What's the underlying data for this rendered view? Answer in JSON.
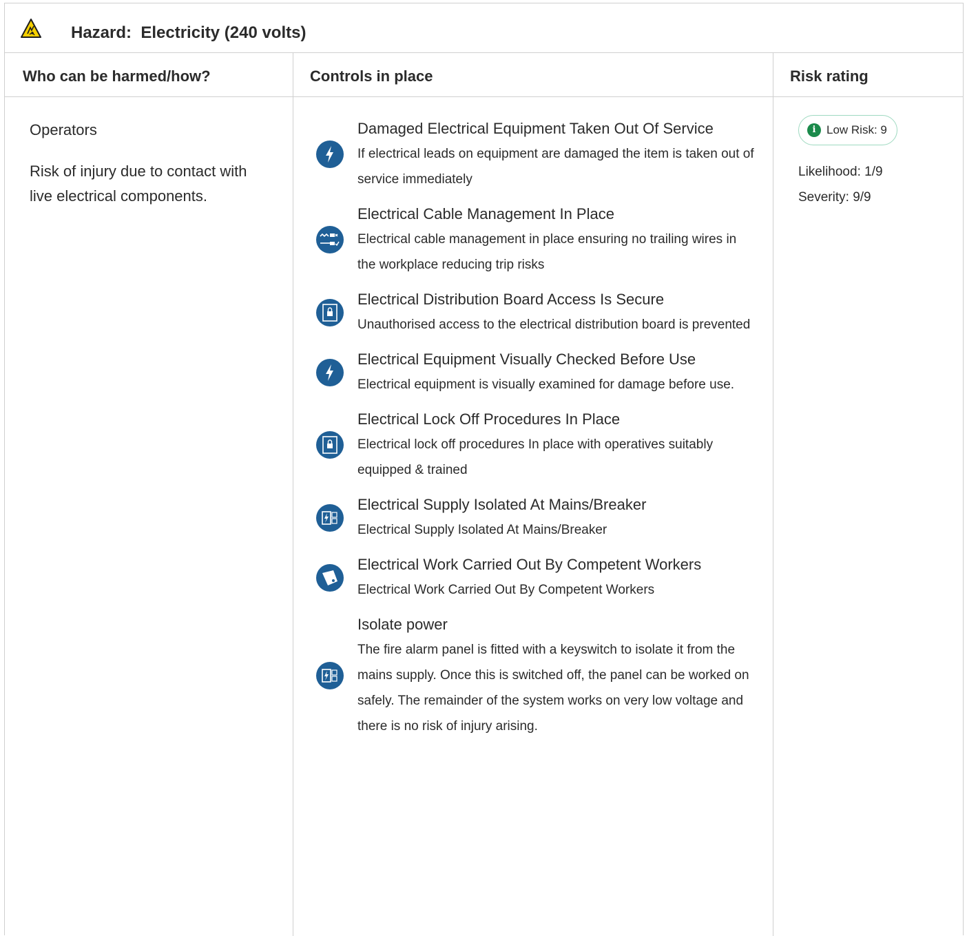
{
  "hazard": {
    "title": "Hazard:  Electricity (240 volts)",
    "icon": "electric-shock-warning-icon"
  },
  "columns": {
    "who": "Who can be harmed/how?",
    "controls": "Controls in place",
    "risk": "Risk rating"
  },
  "who": {
    "name": "Operators",
    "description": "Risk of injury due to contact with live electrical components."
  },
  "controls": [
    {
      "icon": "lightning-bolt-icon",
      "title": "Damaged Electrical Equipment Taken Out Of Service",
      "description": "If electrical leads on equipment are damaged the item is taken out of service immediately"
    },
    {
      "icon": "cable-management-icon",
      "title": "Electrical Cable Management In Place",
      "description": "Electrical cable management in place ensuring no trailing wires in the workplace reducing trip risks"
    },
    {
      "icon": "locked-cabinet-icon",
      "title": "Electrical Distribution Board Access Is Secure",
      "description": "Unauthorised access to the electrical distribution board is prevented"
    },
    {
      "icon": "lightning-bolt-icon",
      "title": "Electrical Equipment Visually Checked Before Use",
      "description": "Electrical equipment is visually examined for damage before use."
    },
    {
      "icon": "locked-cabinet-icon",
      "title": "Electrical Lock Off Procedures In Place",
      "description": "Electrical lock off procedures In place with operatives suitably equipped & trained"
    },
    {
      "icon": "isolation-switch-icon",
      "title": "Electrical Supply Isolated At Mains/Breaker",
      "description": "Electrical Supply Isolated At Mains/Breaker"
    },
    {
      "icon": "competent-worker-tag-icon",
      "title": "Electrical Work Carried Out By Competent Workers",
      "description": "Electrical Work Carried Out By Competent Workers"
    },
    {
      "icon": "isolation-switch-icon",
      "title": "Isolate power",
      "description": "The fire alarm panel is fitted with a keyswitch to isolate it from the mains supply. Once this is switched off, the panel can be worked on safely. The remainder of the system works on very low voltage and there is no risk of injury arising."
    }
  ],
  "risk": {
    "badge": "Low Risk: 9",
    "badge_icon": "info-icon",
    "likelihood": "Likelihood: 1/9",
    "severity": "Severity: 9/9",
    "colors": {
      "badge_border": "#9ed9c0",
      "badge_icon": "#1b8a4b"
    }
  },
  "colors": {
    "icon_blue": "#1f5f96",
    "warning_yellow": "#f5d000"
  }
}
